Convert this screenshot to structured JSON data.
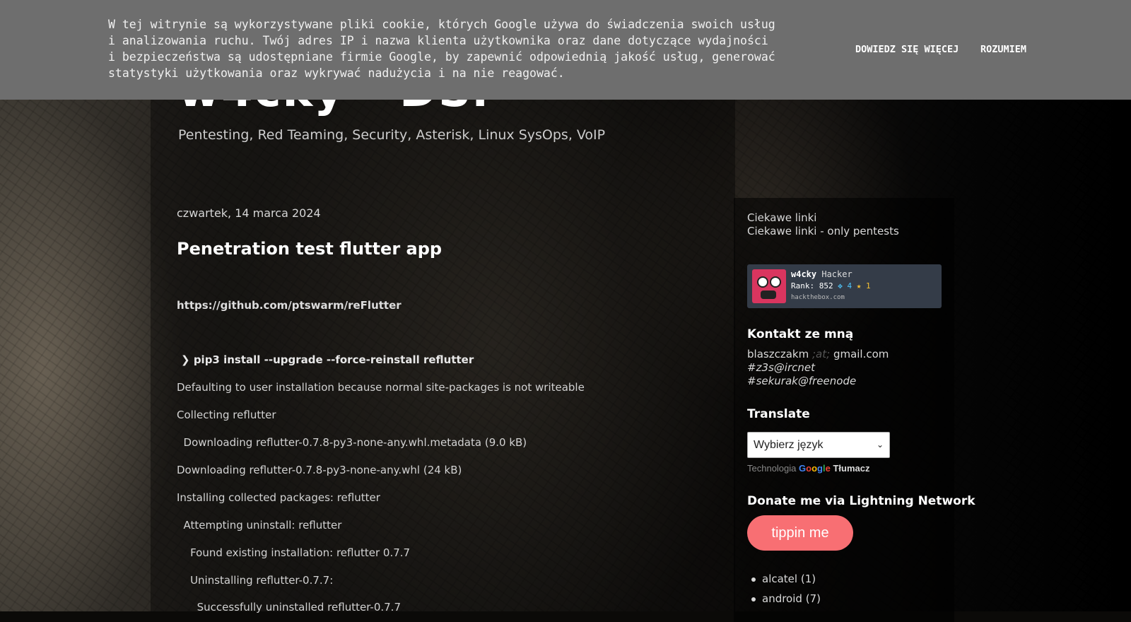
{
  "cookie": {
    "text_lines": [
      "W tej witrynie są wykorzystywane pliki cookie, których Google używa do świadczenia swoich usług",
      "i analizowania ruchu. Twój adres IP i nazwa klienta użytkownika oraz dane dotyczące wydajności",
      "i bezpieczeństwa są udostępniane firmie Google, by zapewnić odpowiednią jakość usług, generować",
      "statystyki użytkowania oraz wykrywać nadużycia i na nie reagować."
    ],
    "learn_more": "Dowiedz się więcej",
    "ok": "Rozumiem"
  },
  "header": {
    "title": "w4cky - DSr",
    "description": "Pentesting, Red Teaming, Security, Asterisk, Linux SysOps, VoIP"
  },
  "post": {
    "date": "czwartek, 14 marca 2024",
    "title": "Penetration test flutter app",
    "link": "https://github.com/ptswarm/reFlutter",
    "command_prompt": "❯",
    "command": "pip3 install --upgrade --force-reinstall reflutter",
    "output": [
      "Defaulting to user installation because normal site-packages is not writeable",
      "Collecting reflutter",
      "  Downloading reflutter-0.7.8-py3-none-any.whl.metadata (9.0 kB)",
      "Downloading reflutter-0.7.8-py3-none-any.whl (24 kB)",
      "Installing collected packages: reflutter",
      "  Attempting uninstall: reflutter",
      "    Found existing installation: reflutter 0.7.7",
      "    Uninstalling reflutter-0.7.7:",
      "      Successfully uninstalled reflutter-0.7.7"
    ]
  },
  "sidebar": {
    "links": [
      "Ciekawe linki",
      "Ciekawe linki - only pentests"
    ],
    "htb": {
      "username": "w4cky",
      "role": "Hacker",
      "rank_label": "Rank: 852",
      "respect": "4",
      "stars": "1",
      "site": "hackthebox.com"
    },
    "contact": {
      "heading": "Kontakt ze mną",
      "email_user": "blaszczakm",
      "email_at": ";at;",
      "email_domain": "gmail.com",
      "irc1": "#z3s@ircnet",
      "irc2": "#sekurak@freenode"
    },
    "translate": {
      "heading": "Translate",
      "select_value": "Wybierz język",
      "powered_prefix": "Technologia",
      "google": "Google",
      "translate_label": "Tłumacz"
    },
    "donate": {
      "heading": "Donate me via Lightning Network",
      "button": "tippin me"
    },
    "labels": [
      {
        "name": "alcatel",
        "count": "(1)"
      },
      {
        "name": "android",
        "count": "(7)"
      }
    ]
  },
  "colors": {
    "cookie_bg": "#6e6e6e",
    "tip_button": "#f86f73",
    "htb_badge": "#343c48",
    "htb_avatar": "#d9355f"
  }
}
